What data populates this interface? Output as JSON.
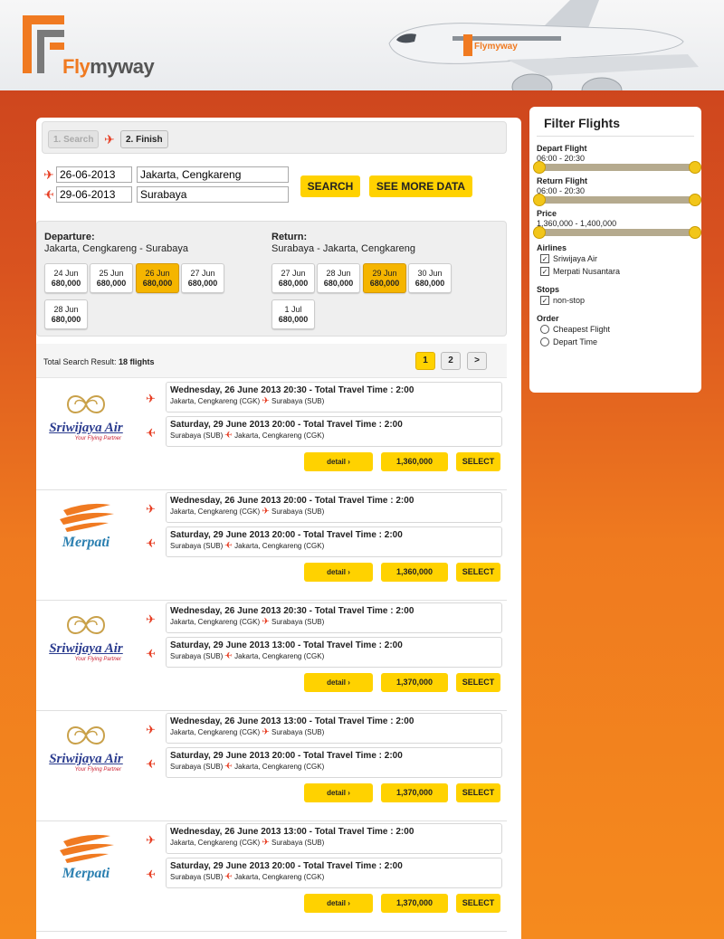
{
  "brand": {
    "name_fly": "Fly",
    "name_rest": "myway",
    "plane_livery": "Flymyway"
  },
  "steps": [
    {
      "label": "1. Search"
    },
    {
      "label": "2. Finish"
    }
  ],
  "search": {
    "depart_date": "26-06-2013",
    "depart_city": "Jakarta, Cengkareng",
    "return_date": "29-06-2013",
    "return_city": "Surabaya",
    "search_label": "SEARCH",
    "more_label": "SEE MORE DATA"
  },
  "departure": {
    "title": "Departure:",
    "route": "Jakarta, Cengkareng - Surabaya",
    "dates": [
      {
        "d": "24 Jun",
        "p": "680,000"
      },
      {
        "d": "25 Jun",
        "p": "680,000"
      },
      {
        "d": "26 Jun",
        "p": "680,000"
      },
      {
        "d": "27 Jun",
        "p": "680,000"
      },
      {
        "d": "28 Jun",
        "p": "680,000"
      }
    ]
  },
  "return": {
    "title": "Return:",
    "route": "Surabaya - Jakarta, Cengkareng",
    "dates": [
      {
        "d": "27 Jun",
        "p": "680,000"
      },
      {
        "d": "28 Jun",
        "p": "680,000"
      },
      {
        "d": "29 Jun",
        "p": "680,000"
      },
      {
        "d": "30 Jun",
        "p": "680,000"
      },
      {
        "d": "1 Jul",
        "p": "680,000"
      }
    ]
  },
  "results": {
    "prefix": "Total Search Result: ",
    "count": "18 flights",
    "pages": [
      "1",
      "2",
      ">"
    ]
  },
  "flights": [
    {
      "airline": "Sriwijaya Air",
      "tagline": "Your Flying Partner",
      "out_title": "Wednesday, 26 June 2013 20:30 - Total Travel Time : 2:00",
      "out_from": "Jakarta, Cengkareng (CGK)",
      "out_to": "Surabaya (SUB)",
      "ret_title": "Saturday, 29 June 2013 20:00 - Total Travel Time : 2:00",
      "ret_from": "Surabaya (SUB)",
      "ret_to": "Jakarta, Cengkareng (CGK)",
      "detail": "detail ›",
      "price": "1,360,000",
      "select": "SELECT"
    },
    {
      "airline": "Merpati",
      "tagline": "",
      "out_title": "Wednesday, 26 June 2013 20:00 - Total Travel Time : 2:00",
      "out_from": "Jakarta, Cengkareng (CGK)",
      "out_to": "Surabaya (SUB)",
      "ret_title": "Saturday, 29 June 2013 20:00 - Total Travel Time : 2:00",
      "ret_from": "Surabaya (SUB)",
      "ret_to": "Jakarta, Cengkareng (CGK)",
      "detail": "detail ›",
      "price": "1,360,000",
      "select": "SELECT"
    },
    {
      "airline": "Sriwijaya Air",
      "tagline": "Your Flying Partner",
      "out_title": "Wednesday, 26 June 2013 20:30 - Total Travel Time : 2:00",
      "out_from": "Jakarta, Cengkareng (CGK)",
      "out_to": "Surabaya (SUB)",
      "ret_title": "Saturday, 29 June 2013 13:00 - Total Travel Time : 2:00",
      "ret_from": "Surabaya (SUB)",
      "ret_to": "Jakarta, Cengkareng (CGK)",
      "detail": "detail ›",
      "price": "1,370,000",
      "select": "SELECT"
    },
    {
      "airline": "Sriwijaya Air",
      "tagline": "Your Flying Partner",
      "out_title": "Wednesday, 26 June 2013 13:00 - Total Travel Time : 2:00",
      "out_from": "Jakarta, Cengkareng (CGK)",
      "out_to": "Surabaya (SUB)",
      "ret_title": "Saturday, 29 June 2013 20:00 - Total Travel Time : 2:00",
      "ret_from": "Surabaya (SUB)",
      "ret_to": "Jakarta, Cengkareng (CGK)",
      "detail": "detail ›",
      "price": "1,370,000",
      "select": "SELECT"
    },
    {
      "airline": "Merpati",
      "tagline": "",
      "out_title": "Wednesday, 26 June 2013 13:00 - Total Travel Time : 2:00",
      "out_from": "Jakarta, Cengkareng (CGK)",
      "out_to": "Surabaya (SUB)",
      "ret_title": "Saturday, 29 June 2013 20:00 - Total Travel Time : 2:00",
      "ret_from": "Surabaya (SUB)",
      "ret_to": "Jakarta, Cengkareng (CGK)",
      "detail": "detail ›",
      "price": "1,370,000",
      "select": "SELECT"
    }
  ],
  "filter": {
    "title": "Filter Flights",
    "depart_label": "Depart Flight",
    "depart_range": "06:00 - 20:30",
    "return_label": "Return Flight",
    "return_range": "06:00 - 20:30",
    "price_label": "Price",
    "price_range": "1,360,000 - 1,400,000",
    "airlines_label": "Airlines",
    "airline_1": "Sriwijaya Air",
    "airline_2": "Merpati Nusantara",
    "stops_label": "Stops",
    "stop_1": "non-stop",
    "order_label": "Order",
    "order_1": "Cheapest Flight",
    "order_2": "Depart Time"
  },
  "colors": {
    "accent": "#f07a21",
    "button": "#ffd200",
    "icon": "#e63a1f",
    "selected_date": "#f5b500"
  },
  "icons": {
    "depart": "plane-right-icon",
    "return": "plane-left-icon"
  }
}
